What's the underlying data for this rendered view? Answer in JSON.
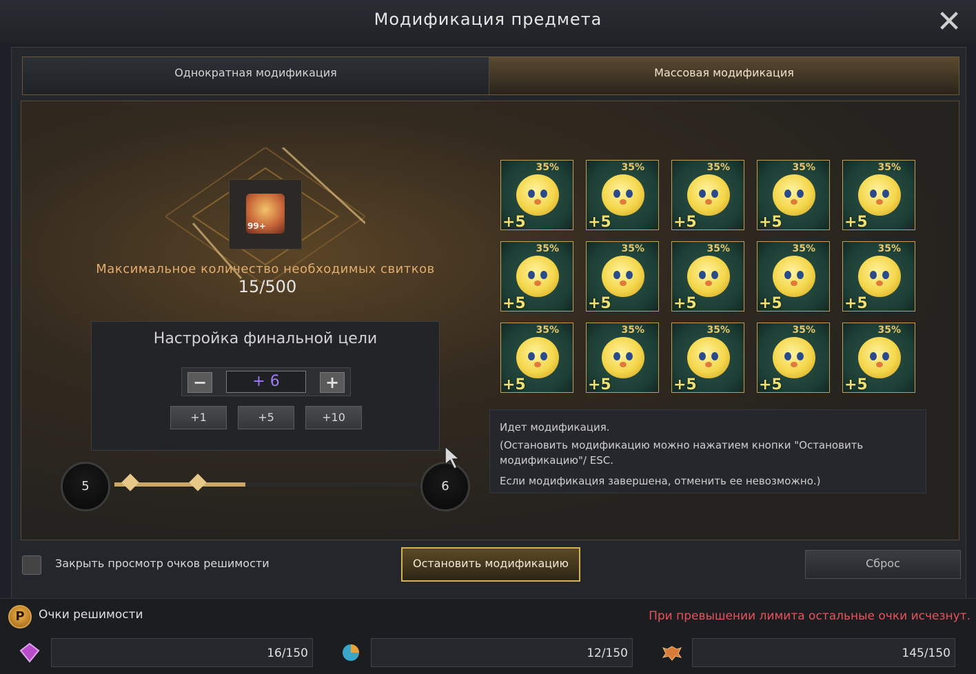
{
  "window": {
    "title": "Модификация предмета",
    "close_icon": "close-icon"
  },
  "tabs": [
    {
      "label": "Однократная модификация",
      "active": false
    },
    {
      "label": "Массовая модификация",
      "active": true
    }
  ],
  "item": {
    "quantity": "99+"
  },
  "scrolls": {
    "label": "Максимальное количество необходимых свитков",
    "value": "15/500"
  },
  "target": {
    "title": "Настройка финальной цели",
    "value": "+ 6",
    "increments": [
      "+1",
      "+5",
      "+10"
    ]
  },
  "level_slider": {
    "from": "5",
    "to": "6"
  },
  "grid": {
    "chance": "35%",
    "level": "+5",
    "count": 15
  },
  "info": {
    "line1": "Идет модификация.",
    "line2": "(Остановить модификацию можно нажатием кнопки \"Остановить",
    "line3": "модификацию\"/ ESC.",
    "line4": "Если модификация завершена, отменить ее невозможно.)"
  },
  "actions": {
    "toggle_label": "Закрыть просмотр очков решимости",
    "stop_label": "Остановить модификацию",
    "reset_label": "Сброс"
  },
  "points": {
    "icon_letter": "P",
    "label": "Очки решимости",
    "warning": "При превышении лимита остальные очки исчезнут.",
    "resources": [
      {
        "icon": "gem-icon",
        "value": "16/150"
      },
      {
        "icon": "orb-icon",
        "value": "12/150"
      },
      {
        "icon": "winged-emblem-icon",
        "value": "145/150"
      }
    ]
  },
  "colors": {
    "accent_gold": "#d9b056",
    "warning_red": "#e8525a",
    "target_purple": "#9d7cf5"
  }
}
